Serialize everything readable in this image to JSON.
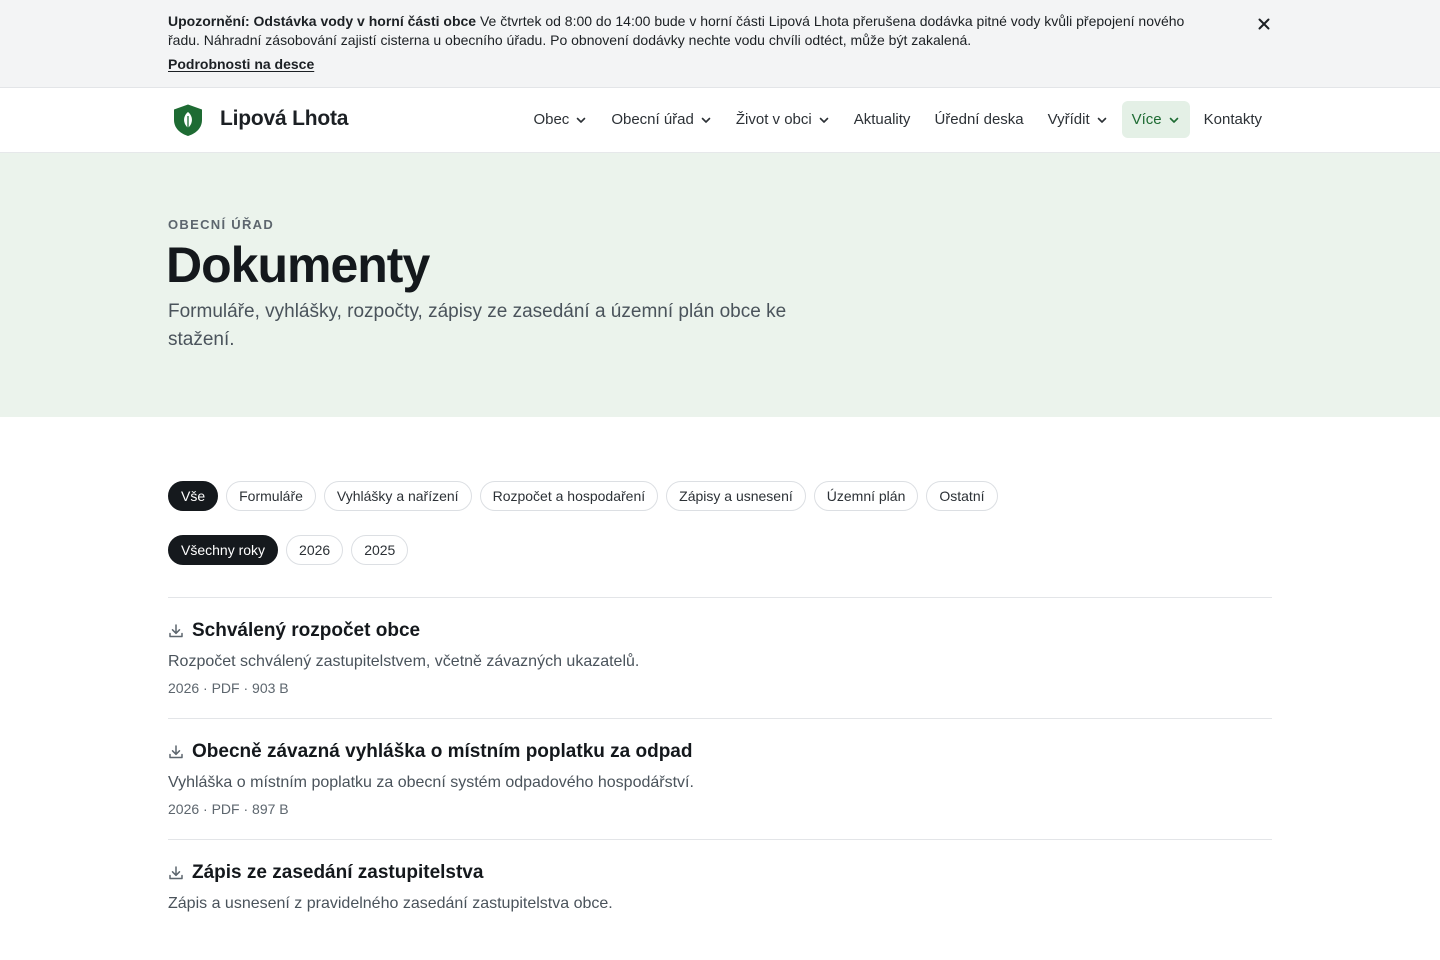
{
  "alert": {
    "title": "Upozornění: Odstávka vody v horní části obce",
    "body": "Ve čtvrtek od 8:00 do 14:00 bude v horní části Lipová Lhota přerušena dodávka pitné vody kvůli přepojení nového řadu. Náhradní zásobování zajistí cisterna u obecního úřadu. Po obnovení dodávky nechte vodu chvíli odtéct, může být zakalená.",
    "link": "Podrobnosti na desce",
    "close_icon": "close-icon"
  },
  "header": {
    "brand": "Lipová Lhota",
    "logo_icon": "shield-leaf-icon",
    "nav": [
      {
        "label": "Obec",
        "dropdown": true
      },
      {
        "label": "Obecní úřad",
        "dropdown": true
      },
      {
        "label": "Život v obci",
        "dropdown": true
      },
      {
        "label": "Aktuality",
        "dropdown": false
      },
      {
        "label": "Úřední deska",
        "dropdown": false
      },
      {
        "label": "Vyřídit",
        "dropdown": true
      },
      {
        "label": "Více",
        "dropdown": true,
        "active": true
      },
      {
        "label": "Kontakty",
        "dropdown": false
      }
    ]
  },
  "hero": {
    "eyebrow": "OBECNÍ ÚŘAD",
    "title": "Dokumenty",
    "lead": "Formuláře, vyhlášky, rozpočty, zápisy ze zasedání a územní plán obce ke stažení."
  },
  "filters": {
    "categories": [
      "Vše",
      "Formuláře",
      "Vyhlášky a nařízení",
      "Rozpočet a hospodaření",
      "Zápisy a usnesení",
      "Územní plán",
      "Ostatní"
    ],
    "selected_category": "Vše",
    "years": [
      "Všechny roky",
      "2026",
      "2025"
    ],
    "selected_year": "Všechny roky"
  },
  "documents": [
    {
      "title": "Schválený rozpočet obce",
      "description": "Rozpočet schválený zastupitelstvem, včetně závazných ukazatelů.",
      "meta": "2026 · PDF · 903 B",
      "icon": "download-icon"
    },
    {
      "title": "Obecně závazná vyhláška o místním poplatku za odpad",
      "description": "Vyhláška o místním poplatku za obecní systém odpadového hospodářství.",
      "meta": "2026 · PDF · 897 B",
      "icon": "download-icon"
    },
    {
      "title": "Zápis ze zasedání zastupitelstva",
      "description": "Zápis a usnesení z pravidelného zasedání zastupitelstva obce.",
      "meta": "",
      "icon": "download-icon"
    }
  ],
  "colors": {
    "accent": "#1e6b33",
    "accent_bg": "#e4f0e6",
    "hero_bg": "#ebf3ec",
    "alert_bg": "#f3f4f5",
    "chip_selected": "#15191d"
  }
}
